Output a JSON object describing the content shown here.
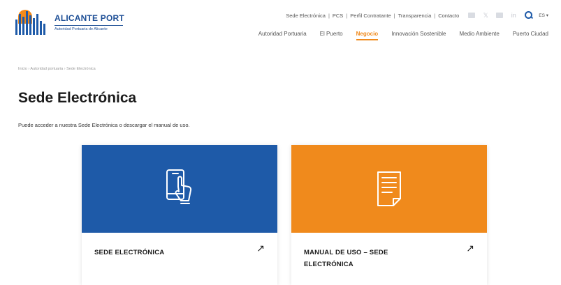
{
  "header": {
    "brand_title": "ALICANTE PORT",
    "brand_subtitle": "Autoridad Portuaria de Alicante",
    "top_links": [
      "Sede Electrónica",
      "PCS",
      "Perfil Contratante",
      "Transparencia",
      "Contacto"
    ],
    "social_icons": [
      "facebook-icon",
      "x-icon",
      "youtube-icon",
      "linkedin-icon"
    ],
    "language": "ES",
    "nav": [
      "Autoridad Portuaria",
      "El Puerto",
      "Negocio",
      "Innovación Sostenible",
      "Medio Ambiente",
      "Puerto Ciudad"
    ],
    "active_nav": "Negocio"
  },
  "breadcrumb": "Inicio › Autoridad portuaria › Sede Electrónica",
  "page": {
    "title": "Sede Electrónica",
    "intro": "Puede acceder a nuestra Sede Electrónica o descargar el manual de uso."
  },
  "cards": [
    {
      "label": "SEDE ELECTRÓNICA",
      "icon": "phone-hand-icon",
      "color": "#1e5aa8",
      "arrow": "↗"
    },
    {
      "label": "MANUAL DE USO – SEDE ELECTRÓNICA",
      "icon": "document-icon",
      "color": "#f08a1c",
      "arrow": "↗"
    }
  ],
  "colors": {
    "brand_blue": "#1e5aa8",
    "accent_orange": "#f08a1c"
  }
}
